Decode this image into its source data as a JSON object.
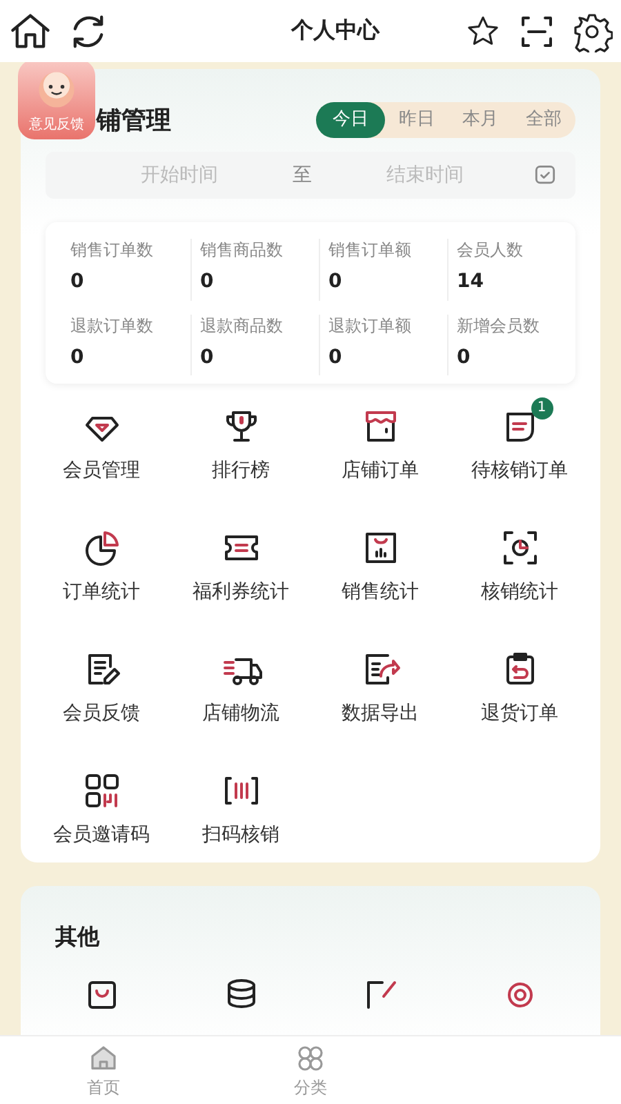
{
  "top_bar": {
    "title": "个人中心"
  },
  "feedback_badge": {
    "label": "意见反馈"
  },
  "shop_panel": {
    "title": "铺管理",
    "ranges": [
      {
        "label": "今日",
        "selected": true
      },
      {
        "label": "昨日",
        "selected": false
      },
      {
        "label": "本月",
        "selected": false
      },
      {
        "label": "全部",
        "selected": false
      }
    ],
    "date_range": {
      "start_placeholder": "开始时间",
      "separator": "至",
      "end_placeholder": "结束时间"
    },
    "stats": [
      {
        "label": "销售订单数",
        "value": "0"
      },
      {
        "label": "销售商品数",
        "value": "0"
      },
      {
        "label": "销售订单额",
        "value": "0"
      },
      {
        "label": "会员人数",
        "value": "14"
      },
      {
        "label": "退款订单数",
        "value": "0"
      },
      {
        "label": "退款商品数",
        "value": "0"
      },
      {
        "label": "退款订单额",
        "value": "0"
      },
      {
        "label": "新增会员数",
        "value": "0"
      }
    ],
    "menu": [
      {
        "label": "会员管理"
      },
      {
        "label": "排行榜"
      },
      {
        "label": "店铺订单"
      },
      {
        "label": "待核销订单",
        "badge": "1"
      },
      {
        "label": "订单统计"
      },
      {
        "label": "福利券统计"
      },
      {
        "label": "销售统计"
      },
      {
        "label": "核销统计"
      },
      {
        "label": "会员反馈"
      },
      {
        "label": "店铺物流"
      },
      {
        "label": "数据导出"
      },
      {
        "label": "退货订单"
      },
      {
        "label": "会员邀请码"
      },
      {
        "label": "扫码核销"
      }
    ]
  },
  "other_panel": {
    "title": "其他"
  },
  "bottom_nav": [
    {
      "label": "首页"
    },
    {
      "label": "分类"
    }
  ]
}
